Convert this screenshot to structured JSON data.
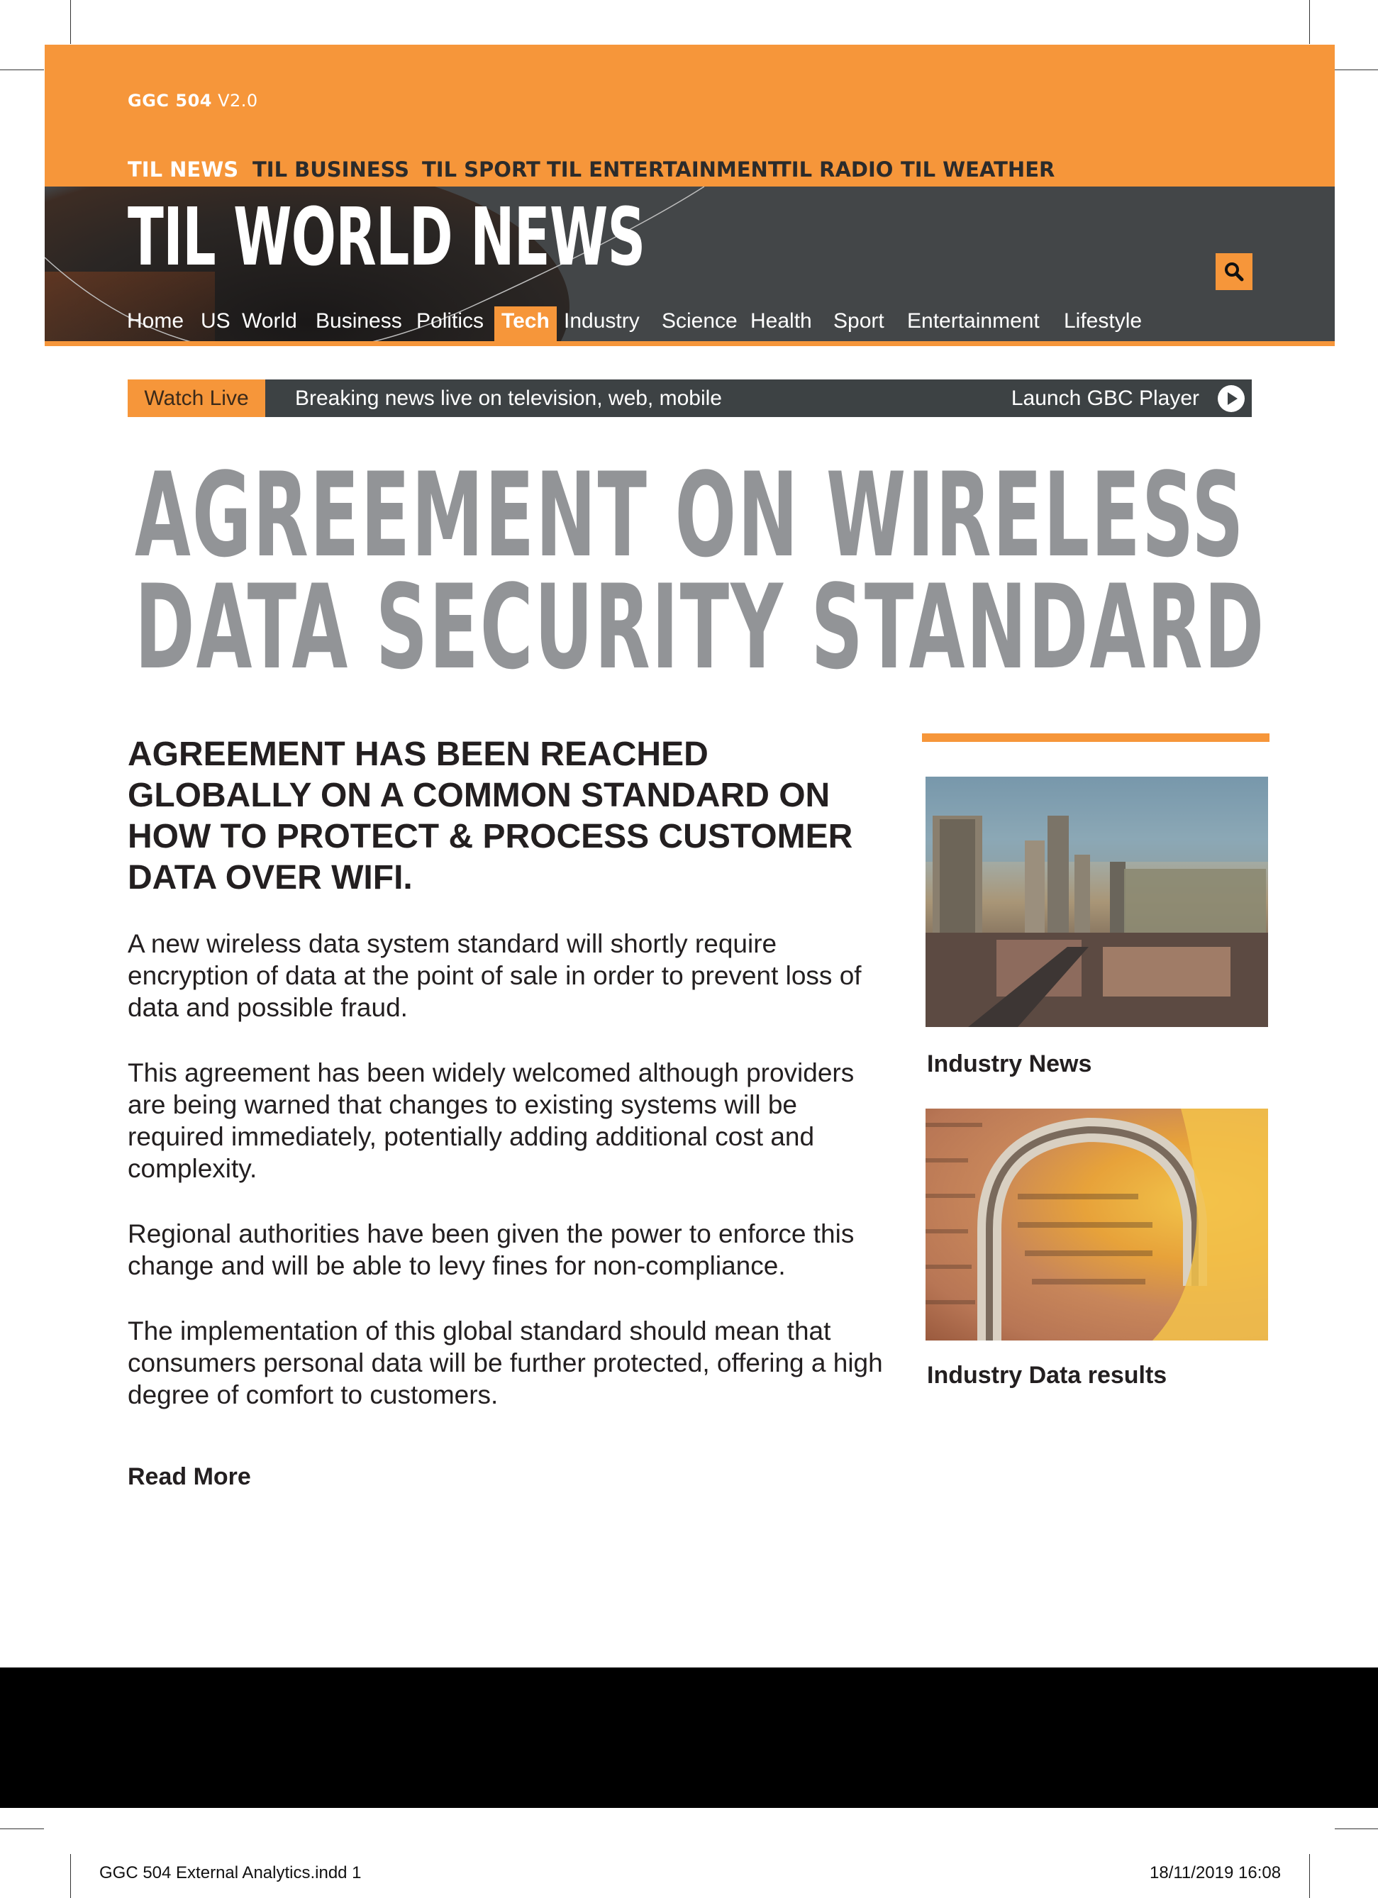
{
  "header": {
    "version_brand": "GGC 504",
    "version_number": "V2.0",
    "brand_nav": [
      "TIL NEWS",
      "TIL BUSINESS",
      "TIL SPORT",
      "TIL ENTERTAINMENT",
      "TIL RADIO",
      "TIL WEATHER"
    ],
    "site_title": "TIL WORLD NEWS",
    "search_icon": "search-icon",
    "main_nav": [
      "Home",
      "US",
      "World",
      "Business",
      "Politics",
      "Tech",
      "Industry",
      "Science",
      "Health",
      "Sport",
      "Entertainment",
      "Lifestyle"
    ],
    "active_main_nav": "Tech"
  },
  "live_bar": {
    "watch_label": "Watch Live",
    "breaking_text": "Breaking news live on television, web, mobile",
    "launch_label": "Launch GBC Player",
    "play_icon": "play-icon"
  },
  "article": {
    "headline_line1": "AGREEMENT ON WIRELESS",
    "headline_line2": "DATA SECURITY STANDARD",
    "subhead": "AGREEMENT HAS BEEN REACHED GLOBALLY ON A COMMON STANDARD ON HOW TO PROTECT & PROCESS CUSTOMER DATA OVER WIFI.",
    "paragraphs": [
      "A new wireless data system standard will shortly require encryption of data at the point of sale in order to prevent loss of data and possible fraud.",
      "This agreement has been widely welcomed although providers are being warned that changes to existing systems will be required immediately, potentially adding additional cost and complexity.",
      "Regional authorities have been given the power to enforce this change and will be able to levy fines for non-compliance.",
      "The implementation of this global standard should mean that consumers personal data will be further protected, offering a high degree of comfort to customers."
    ],
    "read_more": "Read More"
  },
  "sidebar": {
    "items": [
      {
        "caption": "Industry News"
      },
      {
        "caption": "Industry Data results"
      }
    ]
  },
  "slug": {
    "file": "GGC 504 External Analytics.indd   1",
    "date": "18/11/2019   16:08"
  },
  "colors": {
    "accent": "#f6963a",
    "dark_bar": "#434648",
    "headline_gray": "#929497",
    "footer": "#000000"
  }
}
